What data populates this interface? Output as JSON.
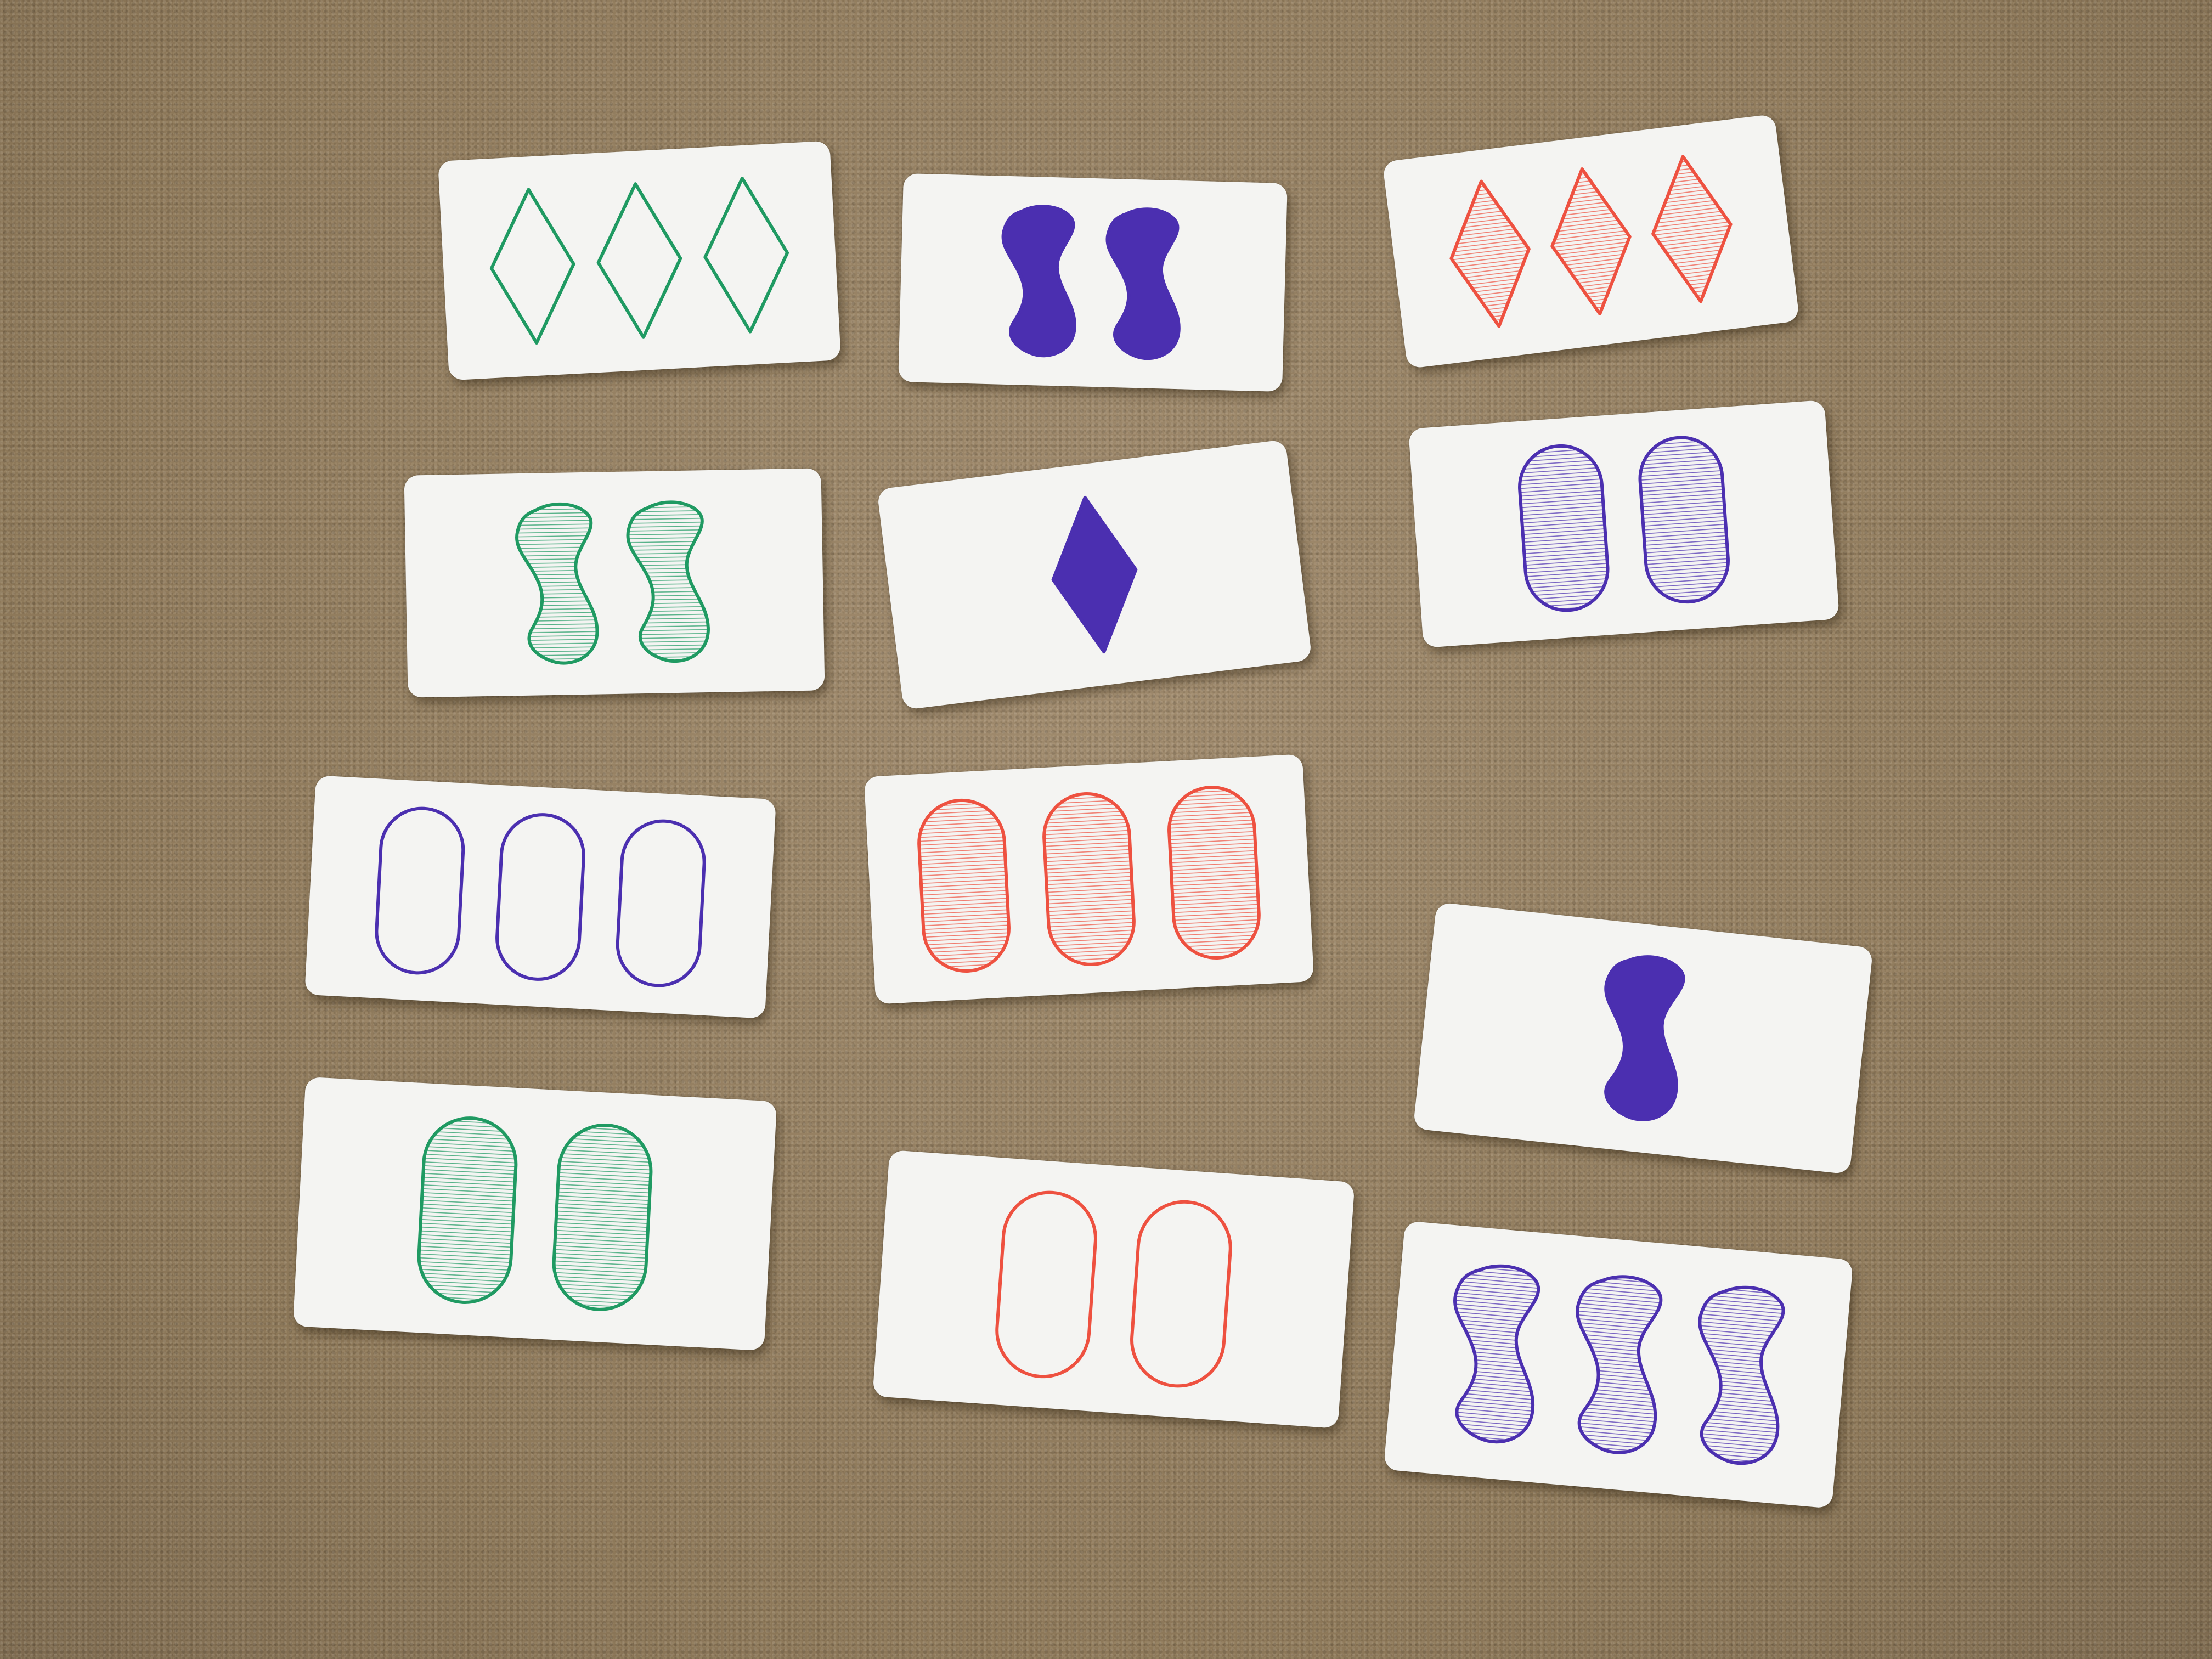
{
  "game": "Set",
  "colors": {
    "green": "#1f9a62",
    "purple": "#4b2fb0",
    "red": "#ee5140"
  },
  "cards": [
    {
      "id": "card-1",
      "count": 3,
      "shape": "diamond",
      "color": "green",
      "fill": "empty"
    },
    {
      "id": "card-2",
      "count": 2,
      "shape": "squiggle",
      "color": "purple",
      "fill": "solid"
    },
    {
      "id": "card-3",
      "count": 3,
      "shape": "diamond",
      "color": "red",
      "fill": "striped"
    },
    {
      "id": "card-4",
      "count": 2,
      "shape": "squiggle",
      "color": "green",
      "fill": "striped"
    },
    {
      "id": "card-5",
      "count": 1,
      "shape": "diamond",
      "color": "purple",
      "fill": "solid"
    },
    {
      "id": "card-6",
      "count": 2,
      "shape": "oval",
      "color": "purple",
      "fill": "striped"
    },
    {
      "id": "card-7",
      "count": 3,
      "shape": "oval",
      "color": "purple",
      "fill": "empty"
    },
    {
      "id": "card-8",
      "count": 3,
      "shape": "oval",
      "color": "red",
      "fill": "striped"
    },
    {
      "id": "card-9",
      "count": 1,
      "shape": "squiggle",
      "color": "purple",
      "fill": "solid"
    },
    {
      "id": "card-10",
      "count": 2,
      "shape": "oval",
      "color": "green",
      "fill": "striped"
    },
    {
      "id": "card-11",
      "count": 2,
      "shape": "oval",
      "color": "red",
      "fill": "empty"
    },
    {
      "id": "card-12",
      "count": 3,
      "shape": "squiggle",
      "color": "purple",
      "fill": "striped"
    }
  ]
}
